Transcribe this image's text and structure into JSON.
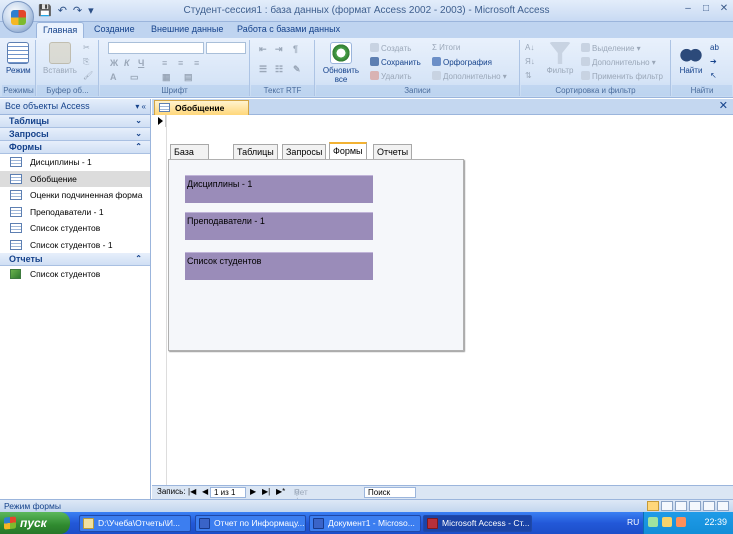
{
  "window": {
    "title": "Студент-сессия1 : база данных (формат Access 2002 - 2003) - Microsoft Access"
  },
  "ribbon": {
    "tabs": [
      "Главная",
      "Создание",
      "Внешние данные",
      "Работа с базами данных"
    ],
    "groups": {
      "views": {
        "label": "Режимы",
        "button": "Режим"
      },
      "clipboard": {
        "label": "Буфер об...",
        "paste": "Вставить"
      },
      "font": {
        "label": "Шрифт"
      },
      "rtf": {
        "label": "Текст RTF"
      },
      "records": {
        "label": "Записи",
        "refresh": "Обновить все",
        "create": "Создать",
        "save": "Сохранить",
        "delete": "Удалить",
        "totals": "Итоги",
        "spelling": "Орфография",
        "more": "Дополнительно"
      },
      "sort": {
        "label": "Сортировка и фильтр",
        "filter": "Фильтр",
        "selection": "Выделение",
        "advanced": "Дополнительно",
        "toggle": "Применить фильтр"
      },
      "find": {
        "label": "Найти",
        "find": "Найти"
      }
    }
  },
  "nav": {
    "header": "Все объекты Access",
    "sections": {
      "tables": "Таблицы",
      "queries": "Запросы",
      "forms": "Формы",
      "reports": "Отчеты"
    },
    "forms": [
      "Дисциплины - 1",
      "Обобщение",
      "Оценки подчиненная форма",
      "Преподаватели - 1",
      "Список студентов",
      "Список студентов - 1"
    ],
    "reports": [
      "Список студентов"
    ]
  },
  "document": {
    "tab": "Обобщение",
    "form_tabs": [
      "База данных",
      "Таблицы",
      "Запросы",
      "Формы",
      "Отчеты"
    ],
    "buttons": [
      "Дисциплины - 1",
      "Преподаватели - 1",
      "Список студентов"
    ]
  },
  "record_nav": {
    "label": "Запись:",
    "position": "1 из 1",
    "filter": "Нет фильтра",
    "search": "Поиск"
  },
  "status": {
    "text": "Режим формы"
  },
  "taskbar": {
    "start": "пуск",
    "tasks": [
      "D:\\Учеба\\Отчеты\\И...",
      "Отчет по Информацу...",
      "Документ1 - Microso...",
      "Microsoft Access - Ст..."
    ],
    "lang": "RU",
    "clock": "22:39"
  }
}
